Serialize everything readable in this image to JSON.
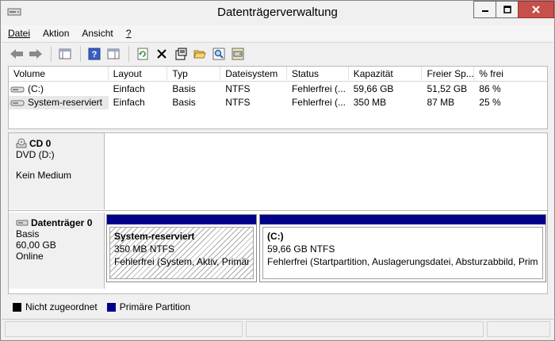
{
  "window": {
    "title": "Datenträgerverwaltung"
  },
  "menu": {
    "items": [
      {
        "label": "Datei",
        "underline": "D",
        "rest": "atei"
      },
      {
        "label": "Aktion",
        "underline": "k",
        "pre": "A",
        "rest": "tion"
      },
      {
        "label": "Ansicht",
        "underline": "A",
        "rest": "nsicht"
      },
      {
        "label": "?",
        "underline": "?",
        "rest": ""
      }
    ]
  },
  "volumes": {
    "columns": [
      "Volume",
      "Layout",
      "Typ",
      "Dateisystem",
      "Status",
      "Kapazität",
      "Freier Sp...",
      "% frei"
    ],
    "rows": [
      {
        "volume": "(C:)",
        "layout": "Einfach",
        "typ": "Basis",
        "fs": "NTFS",
        "status": "Fehlerfrei (...",
        "kapazitaet": "59,66 GB",
        "frei": "51,52 GB",
        "pct": "86 %"
      },
      {
        "volume": "System-reserviert",
        "layout": "Einfach",
        "typ": "Basis",
        "fs": "NTFS",
        "status": "Fehlerfrei (...",
        "kapazitaet": "350 MB",
        "frei": "87 MB",
        "pct": "25 %"
      }
    ]
  },
  "disks": {
    "cd": {
      "name": "CD 0",
      "type": "DVD (D:)",
      "media": "Kein Medium"
    },
    "disk0": {
      "name": "Datenträger 0",
      "kind": "Basis",
      "size": "60,00 GB",
      "state": "Online",
      "partitions": [
        {
          "name": "System-reserviert",
          "size": "350 MB NTFS",
          "status": "Fehlerfrei (System, Aktiv, Primäre P"
        },
        {
          "name": "(C:)",
          "size": "59,66 GB NTFS",
          "status": "Fehlerfrei (Startpartition, Auslagerungsdatei, Absturzabbild, Primäre"
        }
      ]
    }
  },
  "legend": {
    "items": [
      {
        "label": "Nicht zugeordnet",
        "color": "#000000"
      },
      {
        "label": "Primäre Partition",
        "color": "#00008b"
      }
    ]
  },
  "colors": {
    "partition_bar": "#00008b",
    "close_button": "#c7504b"
  }
}
